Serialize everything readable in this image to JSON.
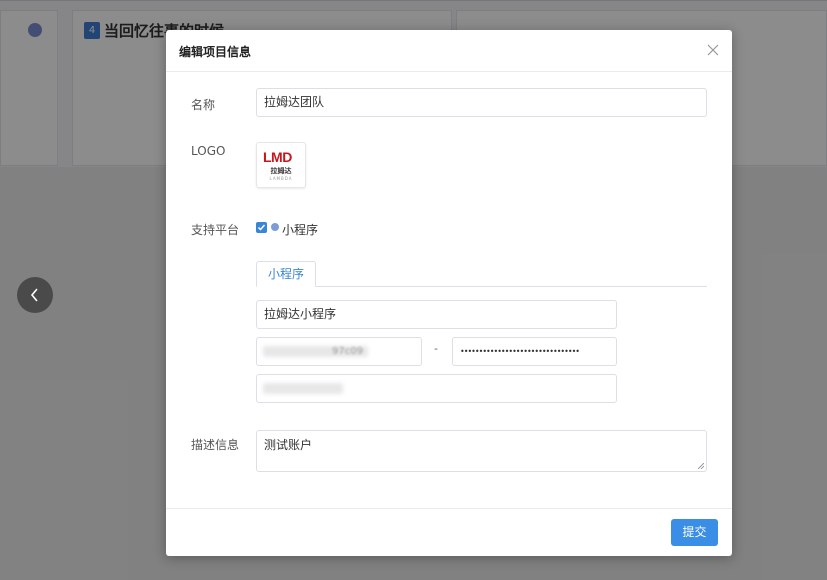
{
  "background": {
    "card_number": "4",
    "card_title": "当回忆往事的时候",
    "icons": [
      "link-icon",
      "chevron-left-icon"
    ]
  },
  "dialog": {
    "title": "编辑项目信息",
    "close_icon": "close-icon",
    "name_label": "名称",
    "name_value": "拉姆达团队",
    "logo_label": "LOGO",
    "logo": {
      "mark": "LMD",
      "sub": "拉姆达",
      "tiny": "LAMBDA"
    },
    "platform_label": "支持平台",
    "platform_option": "小程序",
    "platform_checked": true,
    "tab_label": "小程序",
    "miniapp_name": "拉姆达小程序",
    "appid_visible_fragment": "97c09",
    "separator": "-",
    "secret_value": "••••••••••••••••••••••••••••••••",
    "desc_label": "描述信息",
    "desc_value": "测试账户",
    "submit_label": "提交"
  },
  "colors": {
    "accent": "#3b8ee6",
    "logo_red": "#c8161d",
    "tab_active": "#3b85d6"
  }
}
